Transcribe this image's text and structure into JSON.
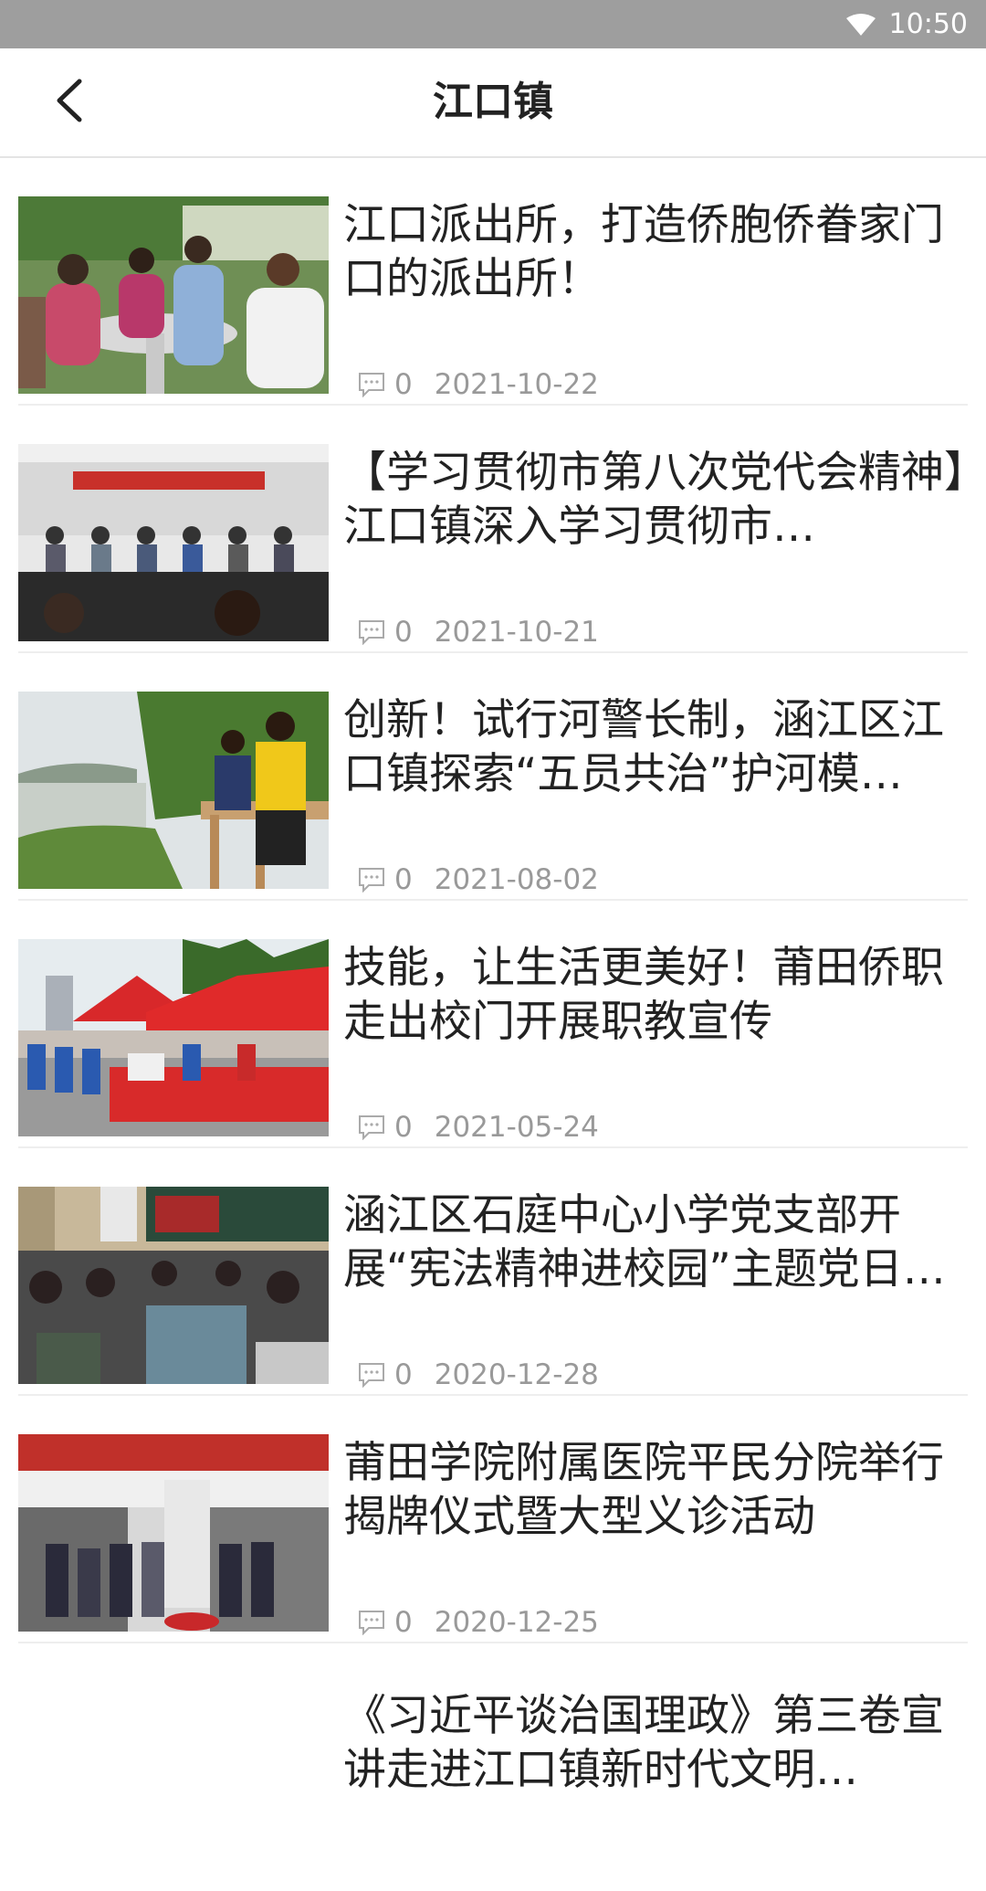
{
  "status_bar": {
    "time": "10:50",
    "wifi_icon": "wifi-icon"
  },
  "header": {
    "title": "江口镇",
    "back_icon": "chevron-left-icon"
  },
  "articles": [
    {
      "title": "江口派出所，打造侨胞侨眷家门口的派出所！",
      "comments": "0",
      "date": "2021-10-22",
      "thumb": "photo-police-meeting-villagers"
    },
    {
      "title": "【学习贯彻市第八次党代会精神】江口镇深入学习贯彻市…",
      "comments": "0",
      "date": "2021-10-21",
      "thumb": "photo-meeting-room"
    },
    {
      "title": "创新！试行河警长制，涵江区江口镇探索“五员共治”护河模…",
      "comments": "0",
      "date": "2021-08-02",
      "thumb": "photo-river-inspection"
    },
    {
      "title": "技能，让生活更美好！莆田侨职走出校门开展职教宣传",
      "comments": "0",
      "date": "2021-05-24",
      "thumb": "photo-outdoor-event-tents"
    },
    {
      "title": "涵江区石庭中心小学党支部开展“宪法精神进校园”主题党日…",
      "comments": "0",
      "date": "2020-12-28",
      "thumb": "photo-classroom-meeting"
    },
    {
      "title": "莆田学院附属医院平民分院举行揭牌仪式暨大型义诊活动",
      "comments": "0",
      "date": "2020-12-25",
      "thumb": "photo-plaque-unveiling"
    },
    {
      "title": "《习近平谈治国理政》第三卷宣讲走进江口镇新时代文明…",
      "comments": "",
      "date": "",
      "thumb": ""
    }
  ],
  "colors": {
    "status_bar": "#9e9e9e",
    "text_primary": "#222222",
    "text_meta": "#999999",
    "divider": "#eeeeee"
  }
}
